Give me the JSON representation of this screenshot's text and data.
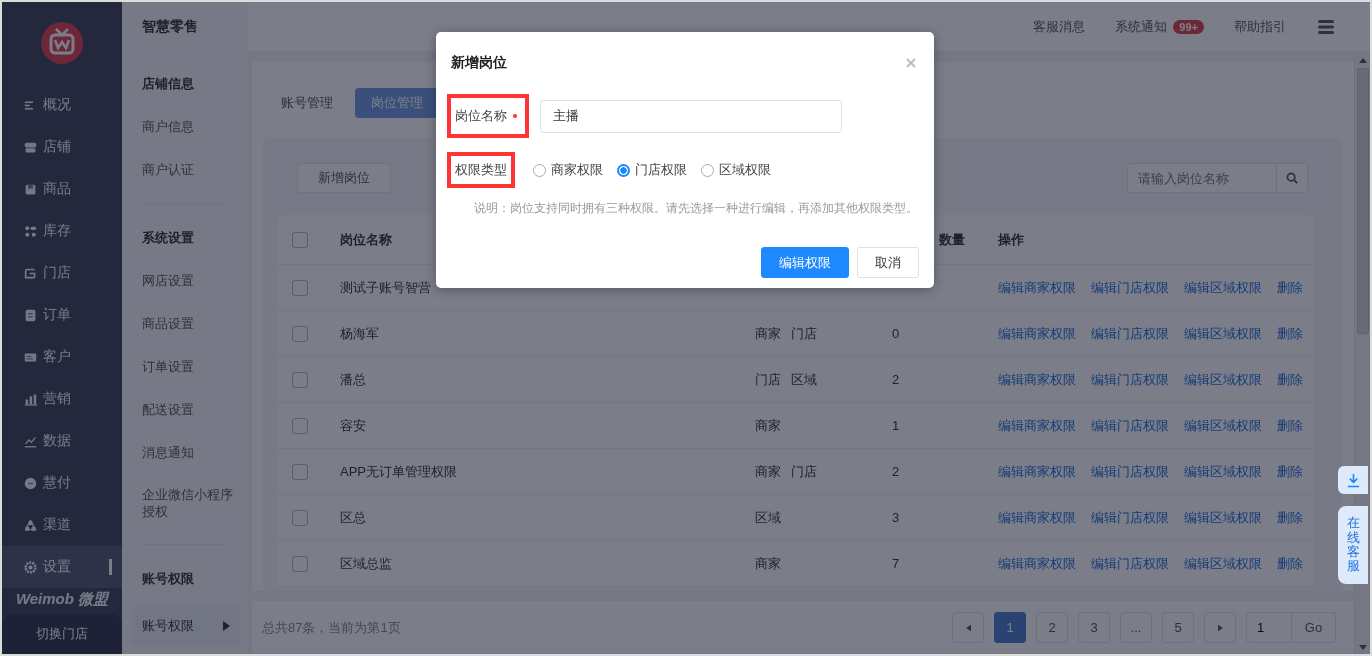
{
  "sidebar": {
    "items": [
      {
        "label": "概况",
        "selected": false
      },
      {
        "label": "店铺",
        "selected": false
      },
      {
        "label": "商品",
        "selected": false
      },
      {
        "label": "库存",
        "selected": false
      },
      {
        "label": "门店",
        "selected": false
      },
      {
        "label": "订单",
        "selected": false
      },
      {
        "label": "客户",
        "selected": false
      },
      {
        "label": "营销",
        "selected": false
      },
      {
        "label": "数据",
        "selected": false
      },
      {
        "label": "慧付",
        "selected": false
      },
      {
        "label": "渠道",
        "selected": false
      },
      {
        "label": "设置",
        "selected": true
      }
    ],
    "brand": "Weimob 微盟",
    "switch_button": "切换门店"
  },
  "subnav": {
    "title": "智慧零售",
    "groups": [
      {
        "heading": "店铺信息",
        "items": [
          {
            "label": "商户信息",
            "selected": false
          },
          {
            "label": "商户认证",
            "selected": false
          }
        ]
      },
      {
        "heading": "系统设置",
        "items": [
          {
            "label": "网店设置",
            "selected": false
          },
          {
            "label": "商品设置",
            "selected": false
          },
          {
            "label": "订单设置",
            "selected": false
          },
          {
            "label": "配送设置",
            "selected": false
          },
          {
            "label": "消息通知",
            "selected": false
          },
          {
            "label": "企业微信小程序授权",
            "selected": false
          }
        ]
      },
      {
        "heading": "账号权限",
        "items": [
          {
            "label": "账号权限",
            "selected": true
          }
        ]
      }
    ]
  },
  "topbar": {
    "links": [
      {
        "label": "客服消息"
      },
      {
        "label": "系统通知",
        "badge": "99+"
      },
      {
        "label": "帮助指引"
      }
    ]
  },
  "tabs": [
    {
      "label": "账号管理",
      "selected": false
    },
    {
      "label": "岗位管理",
      "selected": true
    }
  ],
  "toolbar": {
    "add_button": "新增岗位",
    "search": {
      "placeholder": "请输入岗位名称"
    }
  },
  "table": {
    "all_checked": false,
    "columns": {
      "name": "岗位名称",
      "count": "数量",
      "actions": "操作"
    },
    "rows": [
      {
        "checked": false,
        "name": "测试子账号智营",
        "actions": [
          "编辑商家权限",
          "编辑门店权限",
          "编辑区域权限",
          "删除"
        ]
      },
      {
        "checked": false,
        "name": "杨海军",
        "types": [
          "商家",
          "门店"
        ],
        "count": "0",
        "actions": [
          "编辑商家权限",
          "编辑门店权限",
          "编辑区域权限",
          "删除"
        ]
      },
      {
        "checked": false,
        "name": "潘总",
        "types": [
          "门店",
          "区域"
        ],
        "count": "2",
        "actions": [
          "编辑商家权限",
          "编辑门店权限",
          "编辑区域权限",
          "删除"
        ]
      },
      {
        "checked": false,
        "name": "容安",
        "types": [
          "商家"
        ],
        "count": "1",
        "actions": [
          "编辑商家权限",
          "编辑门店权限",
          "编辑区域权限",
          "删除"
        ]
      },
      {
        "checked": false,
        "name": "APP无订单管理权限",
        "types": [
          "商家",
          "门店"
        ],
        "count": "2",
        "actions": [
          "编辑商家权限",
          "编辑门店权限",
          "编辑区域权限",
          "删除"
        ]
      },
      {
        "checked": false,
        "name": "区总",
        "types": [
          "区域"
        ],
        "count": "3",
        "actions": [
          "编辑商家权限",
          "编辑门店权限",
          "编辑区域权限",
          "删除"
        ]
      },
      {
        "checked": false,
        "name": "区域总监",
        "types": [
          "商家"
        ],
        "count": "7",
        "actions": [
          "编辑商家权限",
          "编辑门店权限",
          "编辑区域权限",
          "删除"
        ]
      }
    ]
  },
  "footer": {
    "summary": "总共87条，当前为第1页",
    "pages": [
      {
        "label": "1",
        "selected": true
      },
      {
        "label": "2",
        "selected": false
      },
      {
        "label": "3",
        "selected": false
      },
      {
        "label": "...",
        "selected": false
      },
      {
        "label": "5",
        "selected": false
      }
    ],
    "jump": {
      "value": "1",
      "button": "Go"
    }
  },
  "float": {
    "service": "在线客服"
  },
  "modal": {
    "title": "新增岗位",
    "name_field": {
      "label": "岗位名称",
      "required": true,
      "value": "主播"
    },
    "type_field": {
      "label": "权限类型",
      "options": [
        {
          "label": "商家权限",
          "selected": false
        },
        {
          "label": "门店权限",
          "selected": true
        },
        {
          "label": "区域权限",
          "selected": false
        }
      ]
    },
    "note": "说明：岗位支持同时拥有三种权限。请先选择一种进行编辑，再添加其他权限类型。",
    "buttons": [
      {
        "label": "编辑权限",
        "kind": "primary"
      },
      {
        "label": "取消",
        "kind": "default"
      }
    ]
  }
}
